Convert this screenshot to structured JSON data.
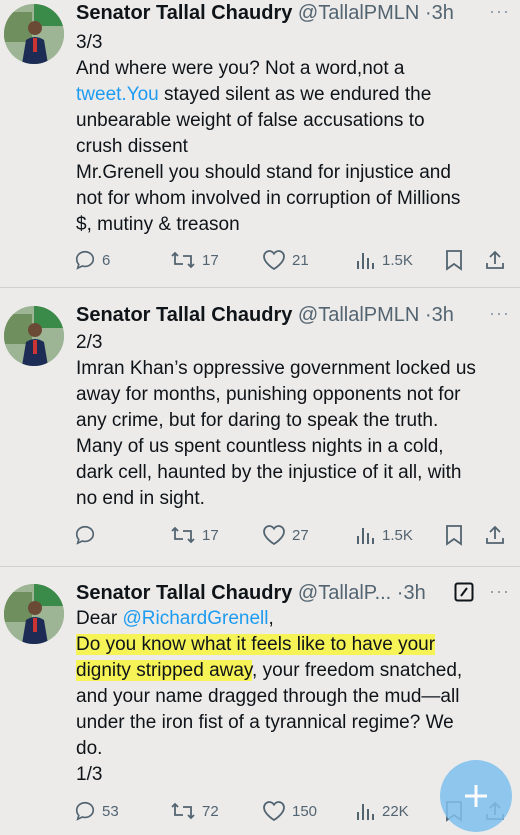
{
  "tweets": [
    {
      "author": "Senator Tallal Chaudry",
      "handle": "@TallalPMLN",
      "sep": "·",
      "time": "3h",
      "more": "···",
      "lines": [
        {
          "t": "3/3"
        },
        {
          "t": "And where were you? Not a word,not a"
        },
        {
          "link": "tweet.You",
          "t": " stayed silent as we endured the"
        },
        {
          "t": "unbearable weight of false accusations to"
        },
        {
          "t": "crush dissent"
        },
        {
          "t": "Mr.Grenell you should stand for injustice and"
        },
        {
          "t": "not for whom involved in corruption of Millions"
        },
        {
          "t": "$, mutiny & treason"
        }
      ],
      "replies": "6",
      "reposts": "17",
      "likes": "21",
      "views": "1.5K"
    },
    {
      "author": "Senator Tallal Chaudry",
      "handle": "@TallalPMLN",
      "sep": "·",
      "time": "3h",
      "more": "···",
      "lines": [
        {
          "t": "2/3"
        },
        {
          "t": "Imran Khan’s oppressive government locked us"
        },
        {
          "t": "away for months, punishing opponents not for"
        },
        {
          "t": "any crime, but for daring to speak the truth."
        },
        {
          "t": "Many of us spent countless nights in a cold,"
        },
        {
          "t": "dark cell, haunted by the injustice of it all, with"
        },
        {
          "t": "no end in sight."
        }
      ],
      "replies": "",
      "reposts": "17",
      "likes": "27",
      "views": "1.5K"
    },
    {
      "author": "Senator Tallal Chaudry",
      "handle": "@TallalP...",
      "sep": "·",
      "time": "3h",
      "more": "···",
      "greeting": "Dear ",
      "mention": "@RichardGrenell",
      "greeting_end": ",",
      "highlight_1": "Do you know what it feels like to have your",
      "highlight_2": "dignity stripped away",
      "line_2_rest": ", your freedom snatched,",
      "lines_rest": [
        "and your name dragged through the mud—all",
        "under the iron fist of a tyrannical regime? We",
        "do.",
        "1/3"
      ],
      "replies": "53",
      "reposts": "72",
      "likes": "150",
      "views": "22K"
    }
  ],
  "colors": {
    "link": "#1d9bf0",
    "highlight": "#f6f357",
    "muted": "#536471",
    "fab": "#7fc0ee"
  },
  "icons": [
    "reply-icon",
    "repost-icon",
    "like-icon",
    "views-icon",
    "bookmark-icon",
    "share-icon",
    "edit-icon",
    "compose-plus-icon"
  ]
}
